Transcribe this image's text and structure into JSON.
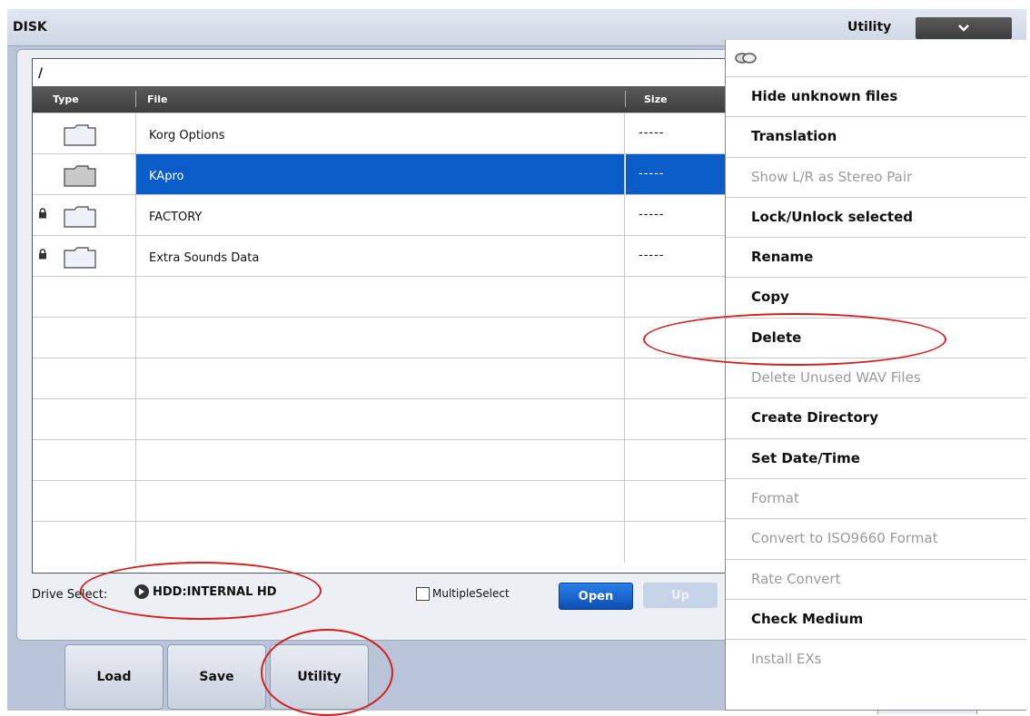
{
  "window": {
    "title": "DISK",
    "menu_label": "Utility"
  },
  "file_browser": {
    "path": "/",
    "columns": [
      "Type",
      "File",
      "Size"
    ],
    "rows": [
      {
        "name": "Korg Options",
        "size": "-----",
        "locked": false,
        "selected": false
      },
      {
        "name": "KApro",
        "size": "-----",
        "locked": false,
        "selected": true
      },
      {
        "name": "FACTORY",
        "size": "-----",
        "locked": true,
        "selected": false
      },
      {
        "name": "Extra Sounds Data",
        "size": "-----",
        "locked": true,
        "selected": false
      }
    ]
  },
  "bottom_bar": {
    "drive_label": "Drive Select:",
    "drive_value": "HDD:INTERNAL HD",
    "multiple_select_label": "MultipleSelect",
    "open_label": "Open",
    "up_label": "Up"
  },
  "tabs": [
    "Load",
    "Save",
    "Utility"
  ],
  "utility_menu": {
    "items": [
      {
        "label": "Hide unknown files",
        "enabled": true
      },
      {
        "label": "Translation",
        "enabled": true
      },
      {
        "label": "Show L/R as Stereo Pair",
        "enabled": false
      },
      {
        "label": "Lock/Unlock selected",
        "enabled": true
      },
      {
        "label": "Rename",
        "enabled": true
      },
      {
        "label": "Copy",
        "enabled": true
      },
      {
        "label": "Delete",
        "enabled": true
      },
      {
        "label": "Delete Unused WAV Files",
        "enabled": false
      },
      {
        "label": "Create Directory",
        "enabled": true
      },
      {
        "label": "Set Date/Time",
        "enabled": true
      },
      {
        "label": "Format",
        "enabled": false
      },
      {
        "label": "Convert to ISO9660 Format",
        "enabled": false
      },
      {
        "label": "Rate Convert",
        "enabled": false
      },
      {
        "label": "Check Medium",
        "enabled": true
      },
      {
        "label": "Install EXs",
        "enabled": false
      }
    ]
  },
  "colors": {
    "selection": "#0a5cc8",
    "annotation": "#d42020",
    "panel_bg": "#b9c4d8"
  },
  "icons": [
    "chevron-down-icon",
    "folder-icon",
    "lock-icon",
    "pin-icon",
    "drive-arrow-icon",
    "checkbox-icon"
  ]
}
